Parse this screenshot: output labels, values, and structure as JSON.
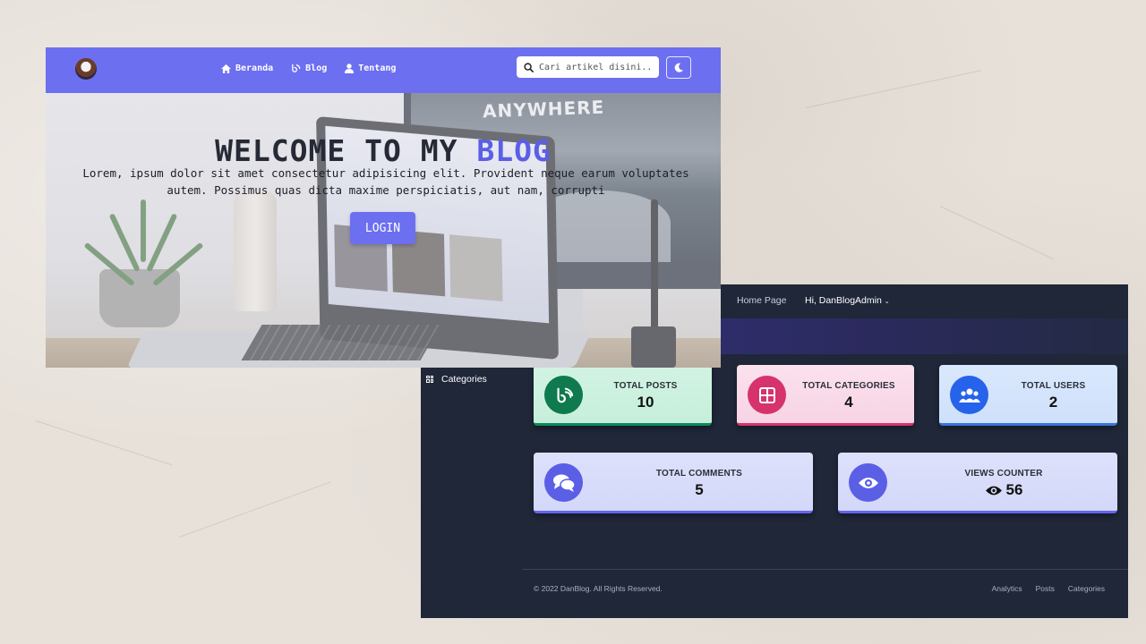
{
  "blog": {
    "nav": {
      "home": "Beranda",
      "blog": "Blog",
      "about": "Tentang"
    },
    "search": {
      "placeholder": "Cari artikel disini..."
    },
    "hero": {
      "title_main": "WELCOME TO MY ",
      "title_accent": "BLOG",
      "description": "Lorem, ipsum dolor sit amet consectetur adipisicing elit. Provident neque earum voluptates autem. Possimus quas dicta maxime perspiciatis, aut nam, corrupti",
      "login_label": "LOGIN"
    },
    "background_text": "ANYWHERE",
    "colors": {
      "navbar": "#6c6ff0",
      "accent": "#5b5fe6"
    }
  },
  "admin": {
    "nav": {
      "home": "Home Page",
      "user": "Hi, DanBlogAdmin"
    },
    "sidebar": {
      "categories": "Categories"
    },
    "stats": {
      "posts": {
        "label": "TOTAL POSTS",
        "value": "10"
      },
      "categories": {
        "label": "TOTAL CATEGORIES",
        "value": "4"
      },
      "users": {
        "label": "TOTAL USERS",
        "value": "2"
      },
      "comments": {
        "label": "TOTAL COMMENTS",
        "value": "5"
      },
      "views": {
        "label": "VIEWS COUNTER",
        "value": "56"
      }
    },
    "footer": {
      "copyright": "© 2022 DanBlog. All Rights Reserved.",
      "links": [
        "Analytics",
        "Posts",
        "Categories"
      ]
    },
    "colors": {
      "background": "#1f2738",
      "posts": "#0e8a5a",
      "categories": "#d6336c",
      "users": "#2563eb",
      "comments": "#5b5fe6"
    }
  }
}
